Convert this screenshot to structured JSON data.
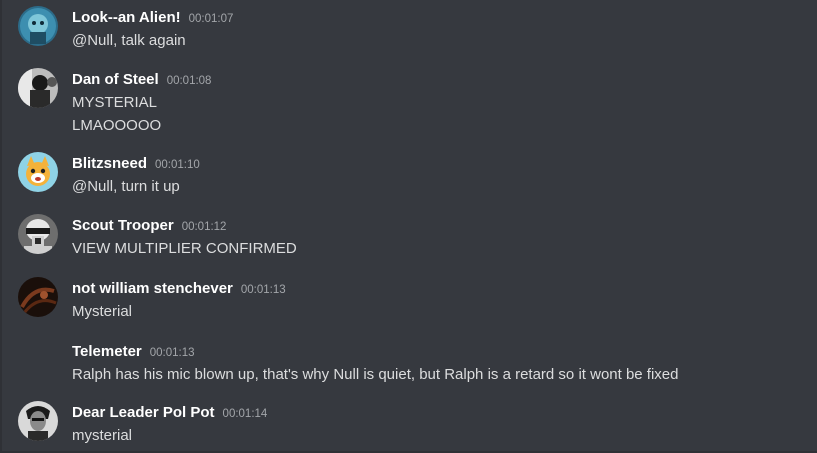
{
  "messages": [
    {
      "username": "Look--an Alien!",
      "timestamp": "00:01:07",
      "avatar_icon": "alien-avatar-icon",
      "lines": [
        "@Null, talk again"
      ]
    },
    {
      "username": "Dan of Steel",
      "timestamp": "00:01:08",
      "avatar_icon": "bw-photo-avatar-icon",
      "lines": [
        "MYSTERIAL",
        "LMAOOOOO"
      ]
    },
    {
      "username": "Blitzsneed",
      "timestamp": "00:01:10",
      "avatar_icon": "cartoon-animal-avatar-icon",
      "lines": [
        "@Null, turn it up"
      ]
    },
    {
      "username": "Scout Trooper",
      "timestamp": "00:01:12",
      "avatar_icon": "trooper-helmet-avatar-icon",
      "lines": [
        "VIEW MULTIPLIER CONFIRMED"
      ]
    },
    {
      "username": "not william stenchever",
      "timestamp": "00:01:13",
      "avatar_icon": "dark-photo-avatar-icon",
      "lines": [
        "Mysterial"
      ]
    },
    {
      "username": "Telemeter",
      "timestamp": "00:01:13",
      "avatar_icon": "",
      "lines": [
        "Ralph has his mic blown up, that's why Null is quiet, but Ralph is a retard so it wont be fixed"
      ]
    },
    {
      "username": "Dear Leader Pol Pot",
      "timestamp": "00:01:14",
      "avatar_icon": "portrait-avatar-icon",
      "lines": [
        "mysterial"
      ]
    }
  ]
}
